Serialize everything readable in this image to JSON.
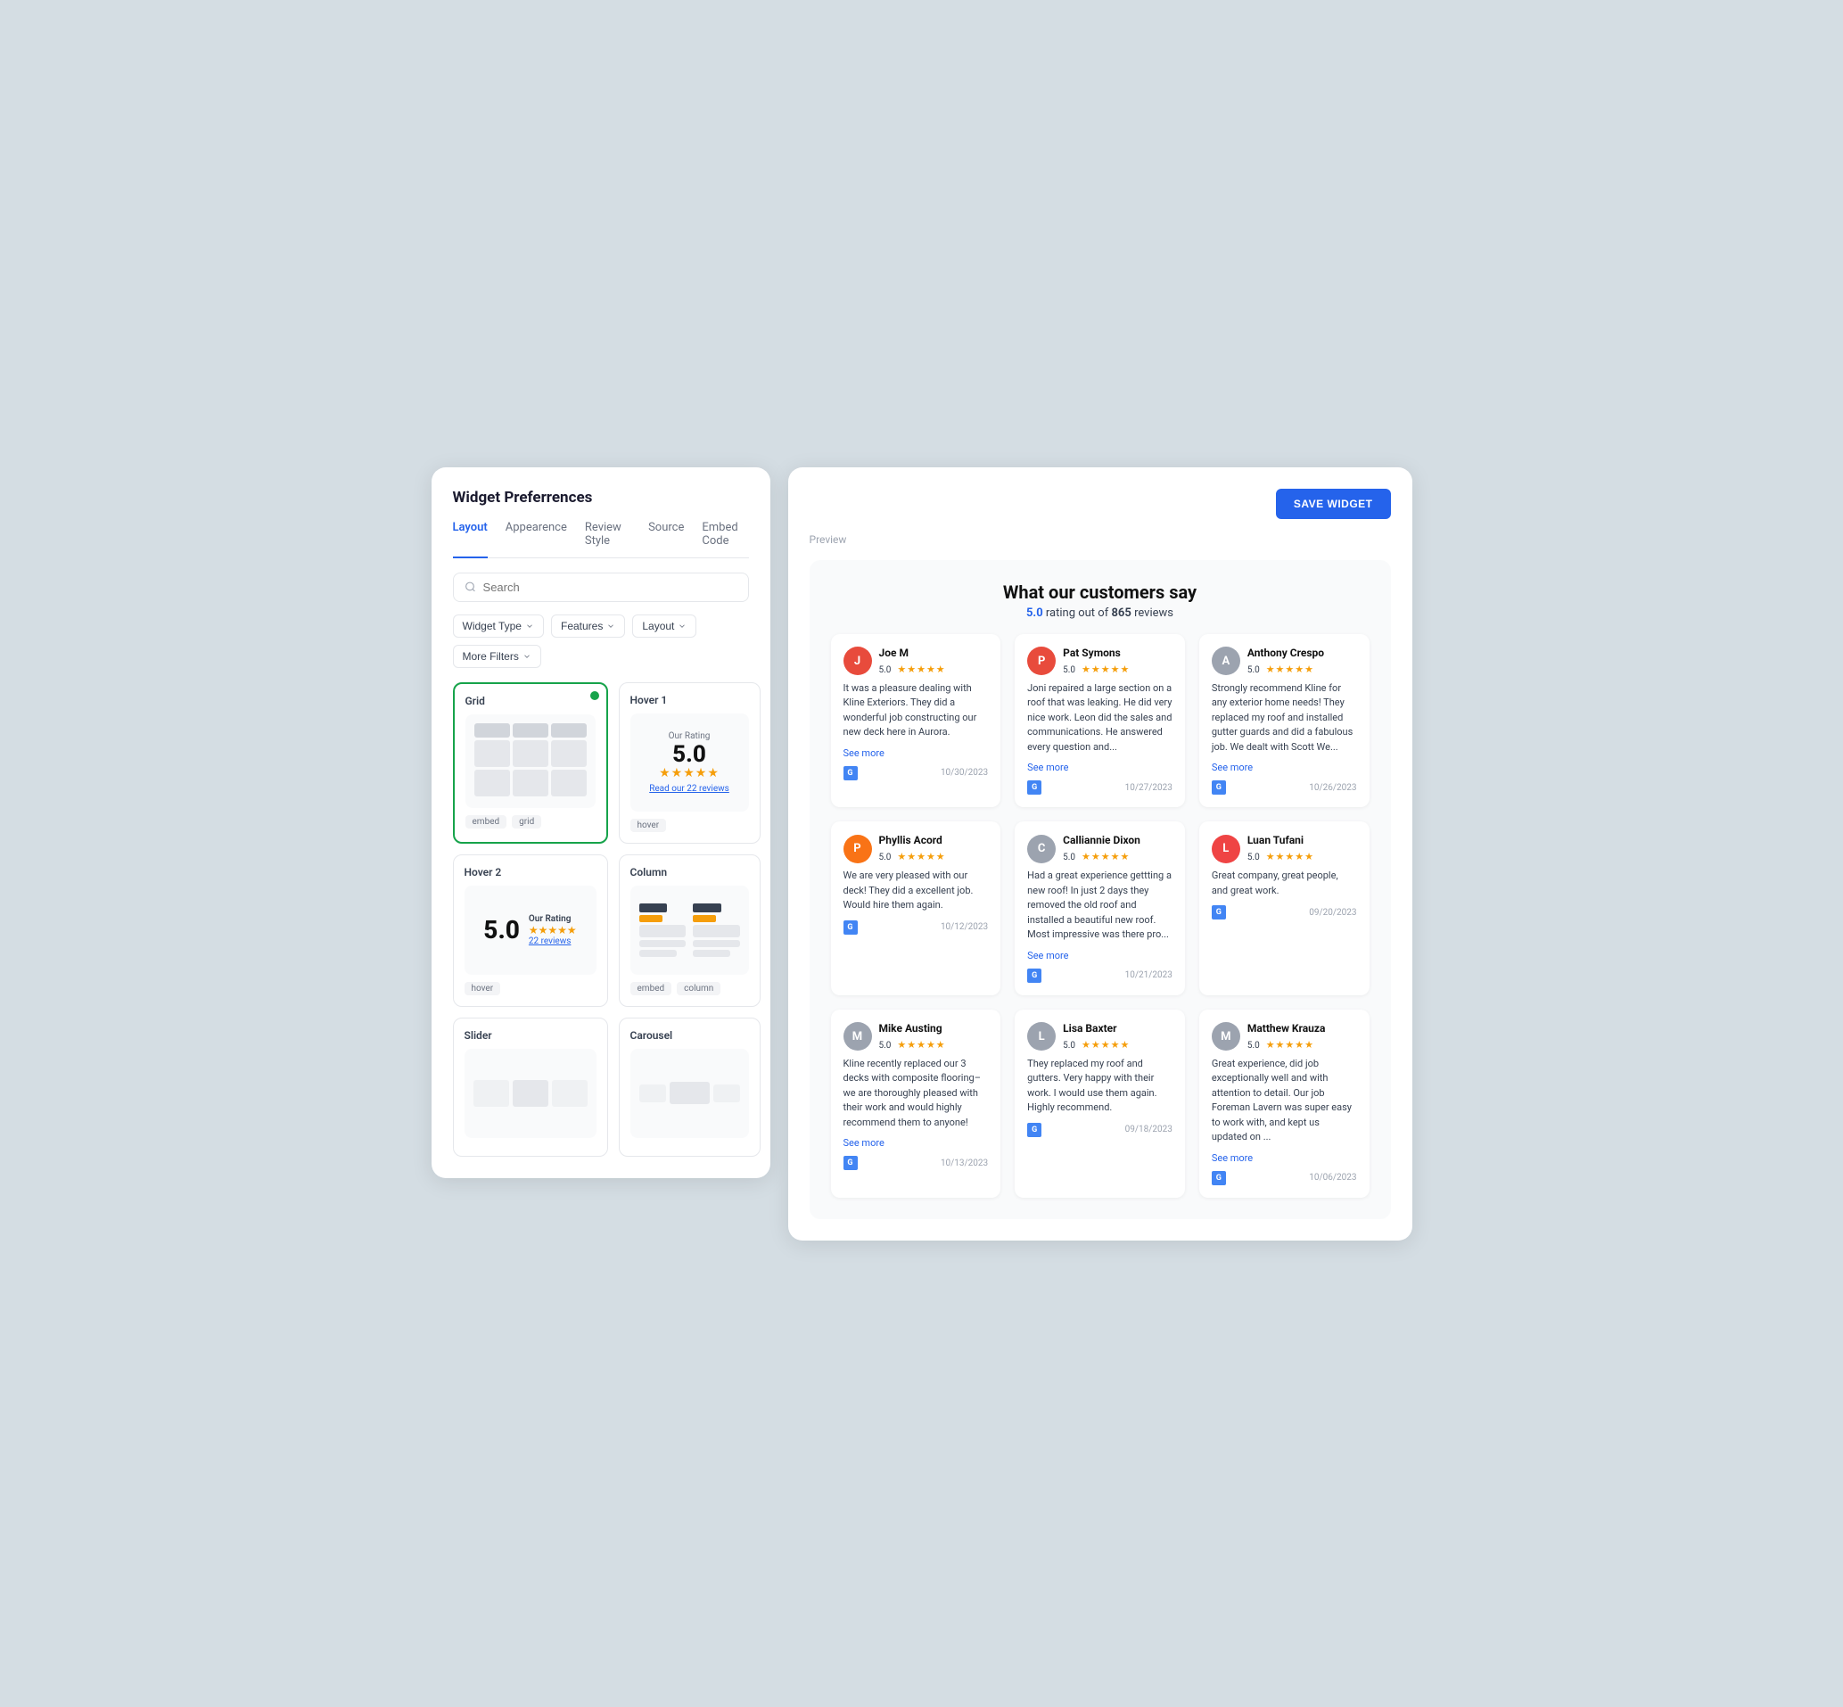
{
  "left_panel": {
    "title": "Widget Preferrences",
    "tabs": [
      {
        "label": "Layout",
        "active": true
      },
      {
        "label": "Appearence",
        "active": false
      },
      {
        "label": "Review Style",
        "active": false
      },
      {
        "label": "Source",
        "active": false
      },
      {
        "label": "Embed Code",
        "active": false
      }
    ],
    "search_placeholder": "Search",
    "filters": [
      {
        "label": "Widget Type",
        "id": "widget-type"
      },
      {
        "label": "Features",
        "id": "features"
      },
      {
        "label": "Layout",
        "id": "layout"
      },
      {
        "label": "More Filters",
        "id": "more-filters"
      }
    ],
    "widgets": [
      {
        "id": "grid",
        "title": "Grid",
        "selected": true,
        "tags": [
          "embed",
          "grid"
        ]
      },
      {
        "id": "hover1",
        "title": "Hover 1",
        "selected": false,
        "tags": [
          "hover"
        ],
        "our_rating_label": "Our Rating",
        "rating": "5.0",
        "read_reviews": "Read our 22 reviews"
      },
      {
        "id": "hover2",
        "title": "Hover 2",
        "selected": false,
        "tags": [
          "hover"
        ],
        "our_rating_label": "Our Rating",
        "rating": "5.0",
        "reviews_text": "22 reviews"
      },
      {
        "id": "column",
        "title": "Column",
        "selected": false,
        "tags": [
          "embed",
          "column"
        ]
      },
      {
        "id": "slider",
        "title": "Slider",
        "selected": false,
        "tags": []
      },
      {
        "id": "carousel",
        "title": "Carousel",
        "selected": false,
        "tags": []
      }
    ]
  },
  "right_panel": {
    "save_button_label": "SAVE WIDGET",
    "preview_label": "Preview",
    "preview": {
      "heading": "What our customers say",
      "rating_value": "5.0",
      "rating_text": "rating out of",
      "review_count": "865",
      "reviews_label": "reviews"
    },
    "reviews": [
      {
        "name": "Joe M",
        "initial": "J",
        "avatar_color": "#e84b3c",
        "score": "5.0",
        "text": "It was a pleasure dealing with Kline Exteriors. They did a wonderful job constructing our new deck here in Aurora.",
        "date": "10/30/2023",
        "has_see_more": true
      },
      {
        "name": "Pat Symons",
        "initial": "P",
        "avatar_color": "#e84b3c",
        "score": "5.0",
        "text": "Joni repaired a large section on a roof that was leaking. He did very nice work. Leon did the sales and communications. He answered every question and...",
        "date": "10/27/2023",
        "has_see_more": true
      },
      {
        "name": "Anthony Crespo",
        "initial": "A",
        "avatar_color": "#9ca3af",
        "score": "5.0",
        "text": "Strongly recommend Kline for any exterior home needs! They replaced my roof and installed gutter guards and did a fabulous job. We dealt with Scott We...",
        "date": "10/26/2023",
        "has_see_more": true
      },
      {
        "name": "Phyllis Acord",
        "initial": "P",
        "avatar_color": "#f97316",
        "score": "5.0",
        "text": "We are very pleased with our deck! They did a excellent job. Would hire them again.",
        "date": "10/12/2023",
        "has_see_more": false
      },
      {
        "name": "Calliannie Dixon",
        "initial": "C",
        "avatar_color": "#9ca3af",
        "score": "5.0",
        "text": "Had a great experience gettting a new roof! In just 2 days they removed the old roof and installed a beautiful new roof. Most impressive was there pro...",
        "date": "10/21/2023",
        "has_see_more": true
      },
      {
        "name": "Luan Tufani",
        "initial": "L",
        "avatar_color": "#ef4444",
        "score": "5.0",
        "text": "Great company, great people, and great work.",
        "date": "09/20/2023",
        "has_see_more": false
      },
      {
        "name": "Mike Austing",
        "initial": "M",
        "avatar_color": "#9ca3af",
        "score": "5.0",
        "text": "Kline recently replaced our 3 decks with composite flooring–we are thoroughly pleased with their work and would highly recommend them to anyone!",
        "date": "10/13/2023",
        "has_see_more": true
      },
      {
        "name": "Lisa Baxter",
        "initial": "L",
        "avatar_color": "#9ca3af",
        "score": "5.0",
        "text": "They replaced my roof and gutters. Very happy with their work. I would use them again. Highly recommend.",
        "date": "09/18/2023",
        "has_see_more": false
      },
      {
        "name": "Matthew Krauza",
        "initial": "M",
        "avatar_color": "#9ca3af",
        "score": "5.0",
        "text": "Great experience, did job exceptionally well and with attention to detail. Our job Foreman Lavern was super easy to work with, and kept us updated on ...",
        "date": "10/06/2023",
        "has_see_more": true
      }
    ]
  }
}
